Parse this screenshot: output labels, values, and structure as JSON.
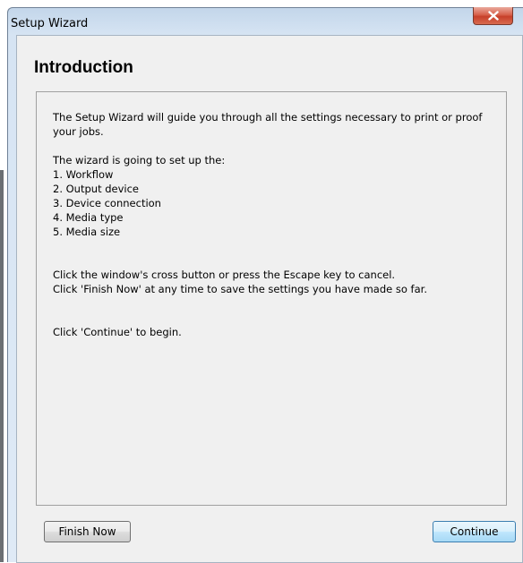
{
  "window": {
    "title": "Setup Wizard"
  },
  "page": {
    "heading": "Introduction"
  },
  "content": {
    "intro": "The Setup Wizard will guide you through all the settings necessary to print or proof your jobs.",
    "list_header": "The wizard is going to set up the:",
    "items": [
      "1. Workflow",
      "2. Output device",
      "3. Device connection",
      "4. Media type",
      "5. Media size"
    ],
    "cancel_hint": "Click the window's cross button or press the Escape key to cancel.",
    "finish_hint": "Click 'Finish Now' at any time to save the settings you have made so far.",
    "begin_hint": "Click 'Continue' to begin."
  },
  "buttons": {
    "finish_now": "Finish Now",
    "continue": "Continue"
  },
  "colors": {
    "close_button": "#c7402a",
    "default_button_border": "#3c7fb1"
  },
  "icons": {
    "close": "close-icon"
  }
}
